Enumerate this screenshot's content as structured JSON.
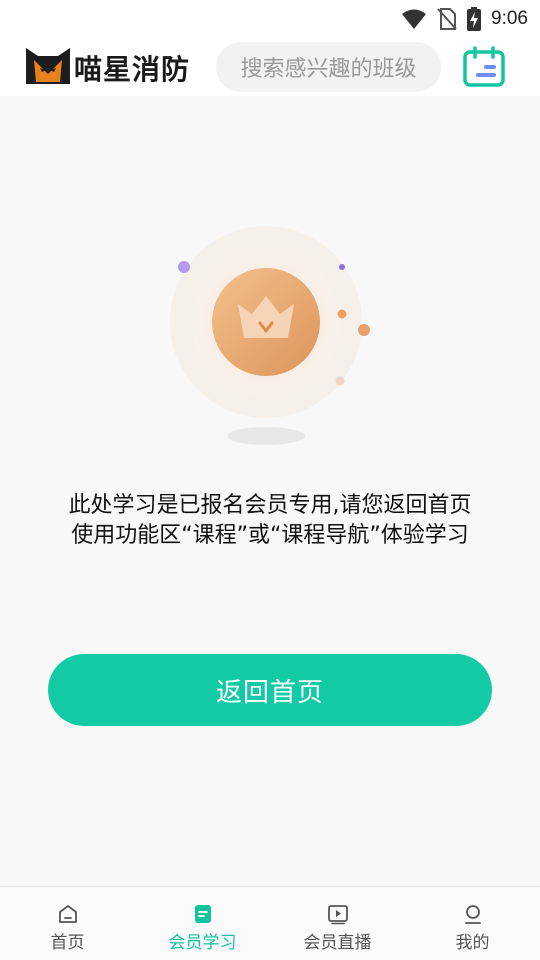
{
  "status_bar": {
    "time": "9:06",
    "icons": [
      "wifi-icon",
      "no-sim-icon",
      "battery-charging-icon"
    ]
  },
  "header": {
    "app_name": "喵星消防",
    "logo_icon": "cat-face-logo",
    "search_placeholder": "搜索感兴趣的班级",
    "calendar_icon": "calendar-icon"
  },
  "main": {
    "illustration_icon": "crown-badge-icon",
    "message_line1": "此处学习是已报名会员专用,请您返回首页",
    "message_line2": "使用功能区“课程”或“课程导航”体验学习",
    "button_label": "返回首页"
  },
  "tab_bar": {
    "tabs": [
      {
        "label": "首页",
        "icon": "home-icon",
        "active": false
      },
      {
        "label": "会员学习",
        "icon": "document-icon",
        "active": true
      },
      {
        "label": "会员直播",
        "icon": "play-icon",
        "active": false
      },
      {
        "label": "我的",
        "icon": "user-icon",
        "active": false
      }
    ]
  },
  "colors": {
    "accent": "#12cba5",
    "active_tab": "#12c39e",
    "badge_orange": "#e8a060"
  }
}
